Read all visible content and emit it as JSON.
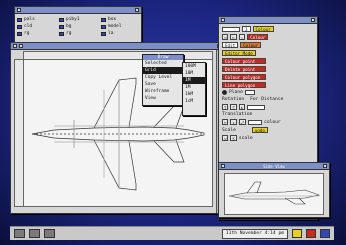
{
  "filer": {
    "items": [
      {
        "label": "pals"
      },
      {
        "label": "piby1"
      },
      {
        "label": "box"
      },
      {
        "label": "cld"
      },
      {
        "label": "bg"
      },
      {
        "label": "model"
      },
      {
        "label": "rg"
      },
      {
        "label": "rg"
      },
      {
        "label": "la"
      }
    ]
  },
  "menu": {
    "title": "Draw",
    "items": [
      "Selected",
      "Grid",
      "Copy Level",
      "Save",
      "Wireframe",
      "View"
    ],
    "highlighted_index": 1
  },
  "submenu": {
    "items": [
      "100M",
      "10M",
      "1M",
      "1M",
      "1kM",
      "1cM"
    ],
    "highlighted_index": 2
  },
  "tools": {
    "top_field": "3",
    "edit_label": "Edit",
    "colour_fields": [
      "Colour",
      "Colour",
      "Colour"
    ],
    "editor_mode_label": "Editor Mode",
    "ops": [
      "Colour point",
      "Delete point",
      "Colour polygon",
      "Line polygon"
    ],
    "plane_label": "Plane",
    "rotation_label": "Rotation",
    "for_distance_label": "For Distance",
    "translation_label": "Translation",
    "scale_label": "Scale",
    "scale_btn": "scale",
    "colour_label": "colour",
    "undo_label": "undo",
    "colors": {
      "yellow": "#e8d020",
      "red": "#c82820",
      "orange": "#e07828"
    }
  },
  "side_view": {
    "title": "Side View"
  },
  "iconbar": {
    "clock": "11th November 4:14 pm"
  }
}
